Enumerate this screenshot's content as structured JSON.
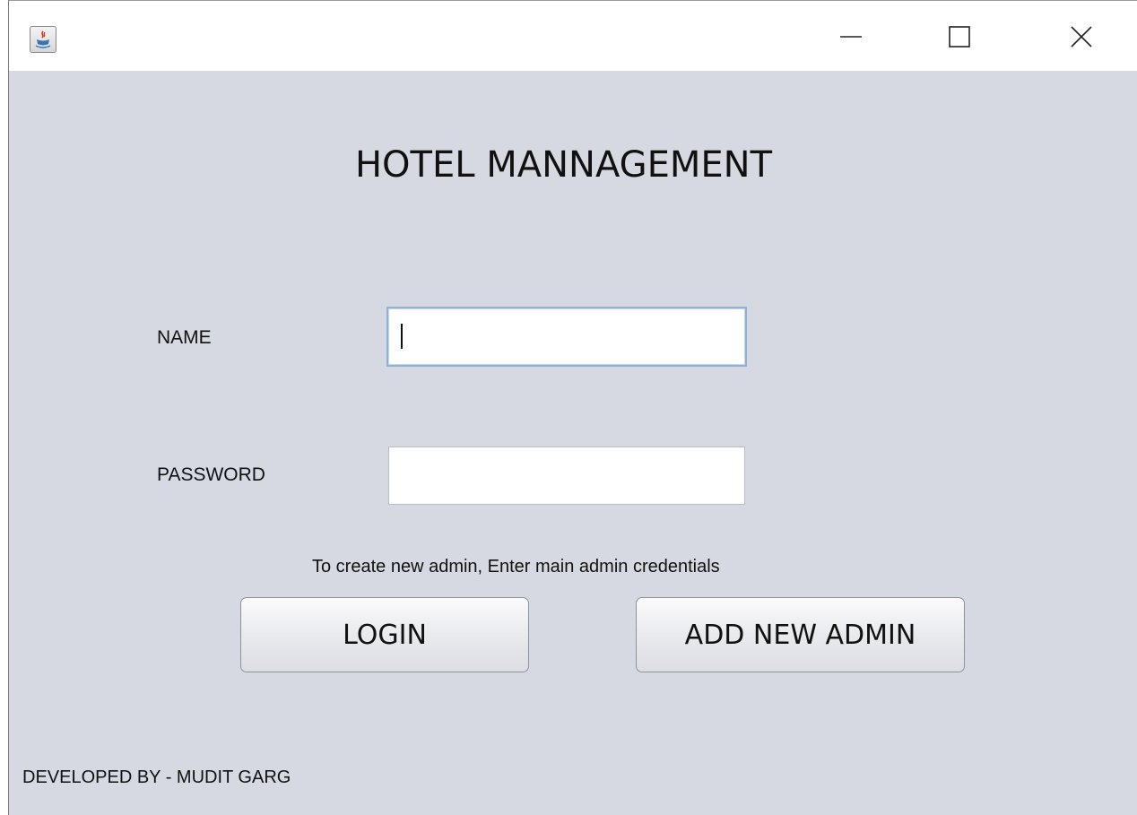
{
  "window": {
    "title_icon": "java-coffee-cup-icon",
    "controls": {
      "minimize": "minimize-icon",
      "maximize": "maximize-icon",
      "close": "close-icon"
    }
  },
  "form": {
    "heading": "HOTEL MANNAGEMENT",
    "name_label": "NAME",
    "name_value": "",
    "password_label": "PASSWORD",
    "password_value": "",
    "hint": "To create new admin, Enter main admin credentials",
    "login_button": "LOGIN",
    "add_admin_button": "ADD NEW ADMIN"
  },
  "footer": {
    "credit": "DEVELOPED BY - MUDIT GARG"
  },
  "colors": {
    "background": "#d6d9e1",
    "titlebar": "#ffffff",
    "focus_border": "#8fb2d6"
  }
}
